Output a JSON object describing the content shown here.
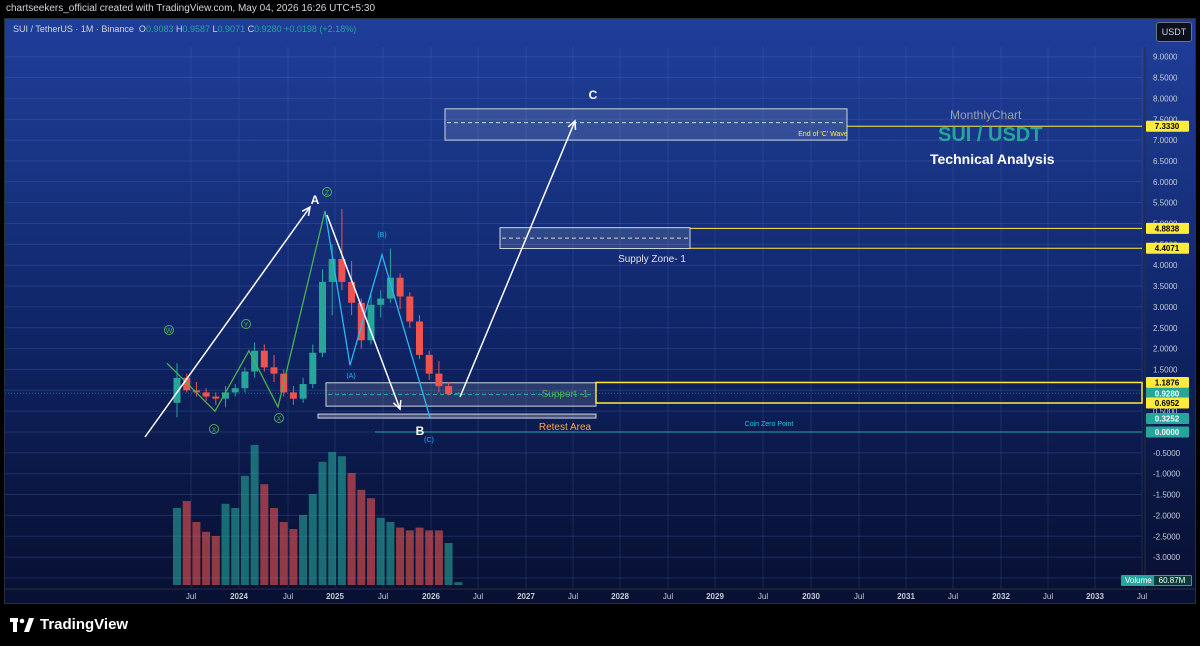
{
  "header": {
    "publisher_text": "chartseekers_official created with TradingView.com, May 04, 2026 16:26 UTC+5:30"
  },
  "symbol": {
    "name": "SUI / TetherUS · 1M · Binance",
    "ohlc_label_o": "O",
    "ohlc_o": "0.9083",
    "ohlc_label_h": "H",
    "ohlc_h": "0.9587",
    "ohlc_label_l": "L",
    "ohlc_l": "0.9071",
    "ohlc_label_c": "C",
    "ohlc_c": "0.9280",
    "change": "+0.0198 (+2.18%)"
  },
  "currency_button": "USDT",
  "annotations": {
    "monthly_chart": "MonthlyChart",
    "pair_title": "SUI / USDT",
    "technical_analysis": "Technical Analysis",
    "end_of_c_wave": "End of 'C' Wave",
    "supply_zone": "Supply Zone- 1",
    "support": "Support -1",
    "retest_area": "Retest Area",
    "coin_zero_point": "Coin Zero Point",
    "wave_a": "A",
    "wave_b": "B",
    "wave_c": "C",
    "wave_w": "W",
    "wave_x1": "X",
    "wave_y": "Y",
    "wave_x2": "X",
    "wave_z": "Z",
    "wave_a_paren": "(A)",
    "wave_b_paren": "(B)",
    "wave_c_paren": "(C)"
  },
  "price_tags": {
    "c_target": "7.3330",
    "supply_top": "4.8838",
    "supply_bottom": "4.4071",
    "support_top": "1.1876",
    "current_price": "0.9280",
    "countdown": "27d 14h",
    "support_bottom": "0.6952",
    "retest": "0.3252",
    "zero": "0.0000"
  },
  "volume_label": "Volume",
  "volume_value": "60.87M",
  "footer": {
    "brand": "TradingView"
  },
  "colors": {
    "up": "#26a69a",
    "down": "#ef5350",
    "accent_yellow": "#ffeb3b",
    "teal_title": "#26a69a",
    "retest_orange": "#f7a64d",
    "zero_line": "#26c6da"
  },
  "chart_data": {
    "type": "candlestick",
    "interval": "1M",
    "y_axis_ticks": [
      "9.0000",
      "8.5000",
      "8.0000",
      "7.5000",
      "7.0000",
      "6.5000",
      "6.0000",
      "5.5000",
      "5.0000",
      "4.5000",
      "4.0000",
      "3.5000",
      "3.0000",
      "2.5000",
      "2.0000",
      "1.5000",
      "1.0000",
      "0.5000",
      "0.0000",
      "-0.5000",
      "-1.0000",
      "-1.5000",
      "-2.0000",
      "-2.5000",
      "-3.0000",
      "-3.5000"
    ],
    "x_axis_labels": [
      "Jul",
      "2024",
      "Jul",
      "2025",
      "Jul",
      "2026",
      "Jul",
      "2027",
      "Jul",
      "2028",
      "Jul",
      "2029",
      "Jul",
      "2030",
      "Jul",
      "2031",
      "Jul",
      "2032",
      "Jul",
      "2033",
      "Jul"
    ],
    "candles": [
      {
        "o": 0.7,
        "h": 1.65,
        "l": 0.35,
        "c": 1.3
      },
      {
        "o": 1.3,
        "h": 1.4,
        "l": 0.95,
        "c": 1.0
      },
      {
        "o": 1.0,
        "h": 1.2,
        "l": 0.85,
        "c": 0.95
      },
      {
        "o": 0.95,
        "h": 1.05,
        "l": 0.75,
        "c": 0.85
      },
      {
        "o": 0.85,
        "h": 0.95,
        "l": 0.65,
        "c": 0.8
      },
      {
        "o": 0.8,
        "h": 1.1,
        "l": 0.6,
        "c": 0.95
      },
      {
        "o": 0.95,
        "h": 1.15,
        "l": 0.85,
        "c": 1.05
      },
      {
        "o": 1.05,
        "h": 1.55,
        "l": 0.95,
        "c": 1.45
      },
      {
        "o": 1.45,
        "h": 2.15,
        "l": 1.3,
        "c": 1.95
      },
      {
        "o": 1.95,
        "h": 2.1,
        "l": 1.45,
        "c": 1.55
      },
      {
        "o": 1.55,
        "h": 1.85,
        "l": 1.2,
        "c": 1.4
      },
      {
        "o": 1.4,
        "h": 1.5,
        "l": 0.85,
        "c": 0.95
      },
      {
        "o": 0.95,
        "h": 1.1,
        "l": 0.65,
        "c": 0.8
      },
      {
        "o": 0.8,
        "h": 1.3,
        "l": 0.7,
        "c": 1.15
      },
      {
        "o": 1.15,
        "h": 2.1,
        "l": 1.05,
        "c": 1.9
      },
      {
        "o": 1.9,
        "h": 3.9,
        "l": 1.8,
        "c": 3.6
      },
      {
        "o": 3.6,
        "h": 4.5,
        "l": 2.8,
        "c": 4.15
      },
      {
        "o": 4.15,
        "h": 5.35,
        "l": 3.4,
        "c": 3.6
      },
      {
        "o": 3.6,
        "h": 4.1,
        "l": 2.8,
        "c": 3.1
      },
      {
        "o": 3.1,
        "h": 3.2,
        "l": 2.0,
        "c": 2.2
      },
      {
        "o": 2.2,
        "h": 3.3,
        "l": 2.1,
        "c": 3.05
      },
      {
        "o": 3.05,
        "h": 3.4,
        "l": 2.75,
        "c": 3.2
      },
      {
        "o": 3.2,
        "h": 4.4,
        "l": 3.1,
        "c": 3.7
      },
      {
        "o": 3.7,
        "h": 3.8,
        "l": 2.95,
        "c": 3.25
      },
      {
        "o": 3.25,
        "h": 3.35,
        "l": 2.5,
        "c": 2.65
      },
      {
        "o": 2.65,
        "h": 2.8,
        "l": 1.75,
        "c": 1.85
      },
      {
        "o": 1.85,
        "h": 1.95,
        "l": 1.25,
        "c": 1.4
      },
      {
        "o": 1.4,
        "h": 1.7,
        "l": 0.95,
        "c": 1.1
      },
      {
        "o": 1.1,
        "h": 1.2,
        "l": 0.88,
        "c": 0.91
      },
      {
        "o": 0.91,
        "h": 0.96,
        "l": 0.9,
        "c": 0.93
      }
    ],
    "volume_bars": [
      {
        "v": 0.55,
        "up": true
      },
      {
        "v": 0.6,
        "up": false
      },
      {
        "v": 0.45,
        "up": false
      },
      {
        "v": 0.38,
        "up": false
      },
      {
        "v": 0.35,
        "up": false
      },
      {
        "v": 0.58,
        "up": true
      },
      {
        "v": 0.55,
        "up": true
      },
      {
        "v": 0.78,
        "up": true
      },
      {
        "v": 1.0,
        "up": true
      },
      {
        "v": 0.72,
        "up": false
      },
      {
        "v": 0.55,
        "up": false
      },
      {
        "v": 0.45,
        "up": false
      },
      {
        "v": 0.4,
        "up": false
      },
      {
        "v": 0.5,
        "up": true
      },
      {
        "v": 0.65,
        "up": true
      },
      {
        "v": 0.88,
        "up": true
      },
      {
        "v": 0.95,
        "up": true
      },
      {
        "v": 0.92,
        "up": true
      },
      {
        "v": 0.8,
        "up": false
      },
      {
        "v": 0.68,
        "up": false
      },
      {
        "v": 0.62,
        "up": false
      },
      {
        "v": 0.48,
        "up": true
      },
      {
        "v": 0.45,
        "up": true
      },
      {
        "v": 0.41,
        "up": false
      },
      {
        "v": 0.39,
        "up": false
      },
      {
        "v": 0.41,
        "up": false
      },
      {
        "v": 0.39,
        "up": false
      },
      {
        "v": 0.39,
        "up": false
      },
      {
        "v": 0.3,
        "up": true
      },
      {
        "v": 0.02,
        "up": true
      }
    ],
    "levels": {
      "c_target": 7.333,
      "supply_top": 4.8838,
      "supply_bottom": 4.4071,
      "support_top": 1.1876,
      "current": 0.928,
      "support_bottom": 0.6952,
      "retest": 0.3252,
      "zero": 0.0
    }
  }
}
